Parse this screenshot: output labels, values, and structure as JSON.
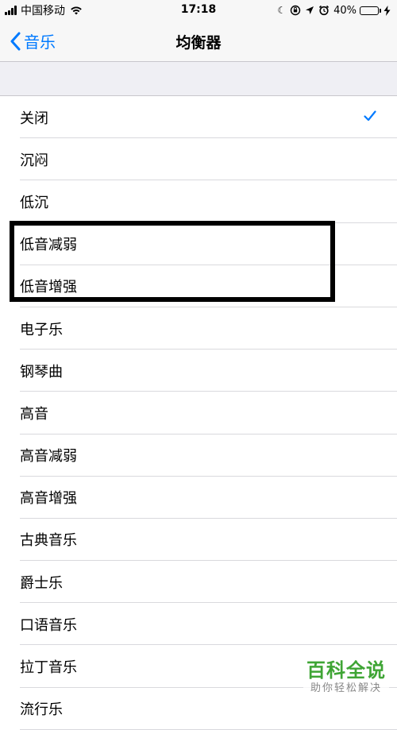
{
  "status_bar": {
    "carrier": "中国移动",
    "time": "17:18",
    "battery_percent": "40%",
    "battery_level": 0.4,
    "icons": [
      "signal-icon",
      "wifi-icon",
      "moon-icon",
      "orientation-lock-icon",
      "location-icon",
      "alarm-icon",
      "battery-icon",
      "charging-icon"
    ]
  },
  "nav": {
    "back_label": "音乐",
    "title": "均衡器"
  },
  "equalizer": {
    "selected": "关闭",
    "items": [
      {
        "label": "关闭"
      },
      {
        "label": "沉闷"
      },
      {
        "label": "低沉"
      },
      {
        "label": "低音减弱"
      },
      {
        "label": "低音增强"
      },
      {
        "label": "电子乐"
      },
      {
        "label": "钢琴曲"
      },
      {
        "label": "高音"
      },
      {
        "label": "高音减弱"
      },
      {
        "label": "高音增强"
      },
      {
        "label": "古典音乐"
      },
      {
        "label": "爵士乐"
      },
      {
        "label": "口语音乐"
      },
      {
        "label": "拉丁音乐"
      },
      {
        "label": "流行乐"
      }
    ]
  },
  "colors": {
    "accent": "#007aff",
    "highlight_box": "#000000",
    "watermark": "#3fa535"
  },
  "watermark": {
    "title": "百科全说",
    "subtitle": "助你轻松解决"
  }
}
